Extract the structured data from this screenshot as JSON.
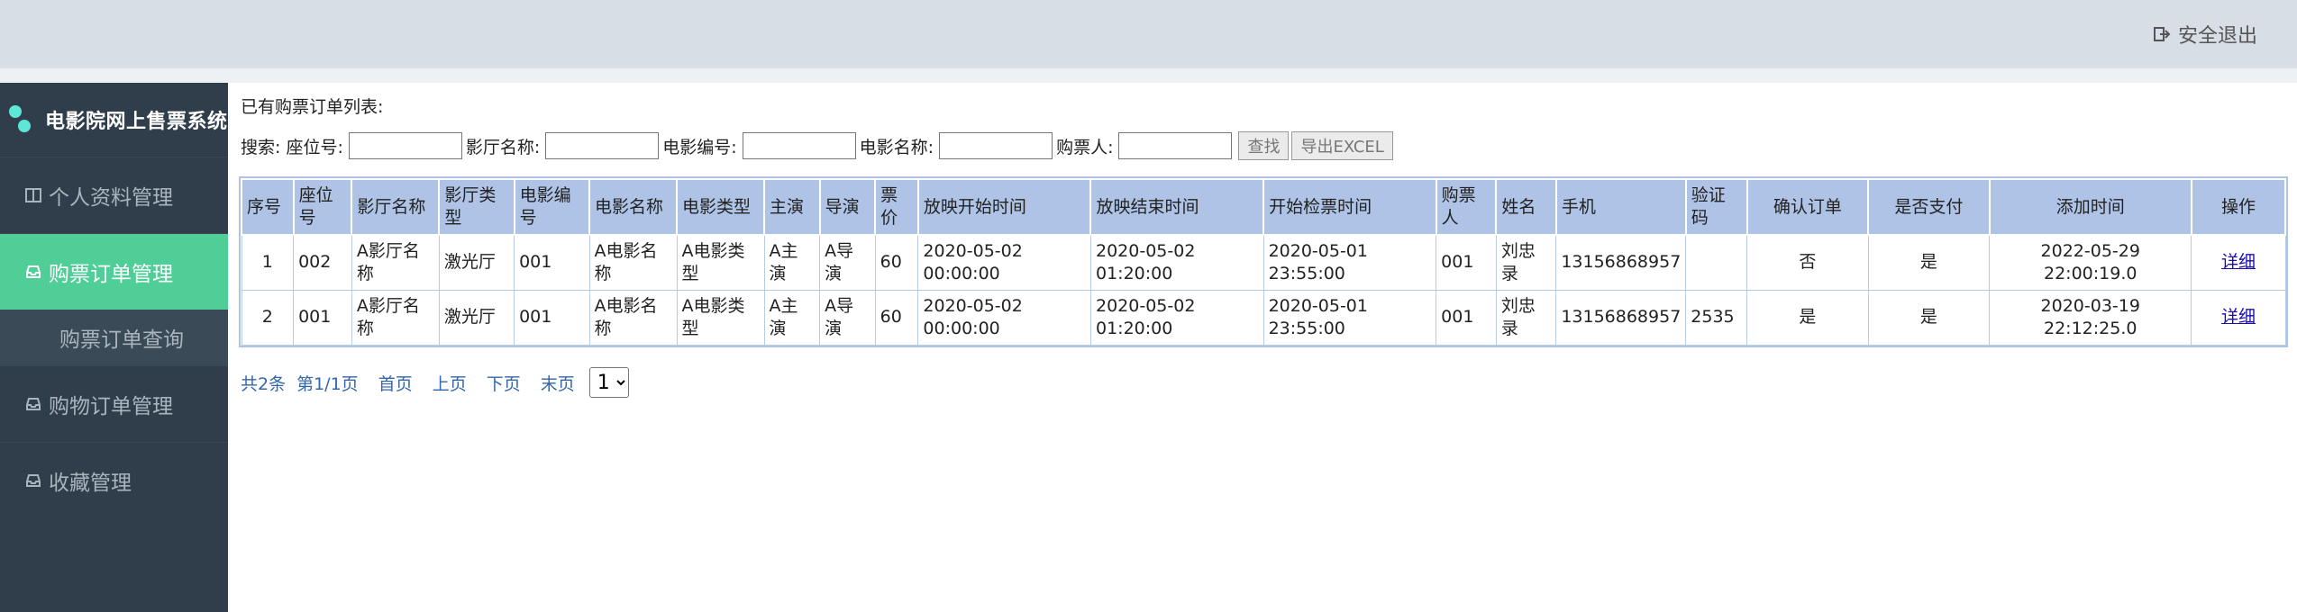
{
  "header": {
    "logout_label": "安全退出"
  },
  "sidebar": {
    "brand": "电影院网上售票系统",
    "items": [
      {
        "label": "个人资料管理",
        "active": false
      },
      {
        "label": "购票订单管理",
        "active": true
      },
      {
        "label": "购物订单管理",
        "active": false
      },
      {
        "label": "收藏管理",
        "active": false
      }
    ],
    "sub_item": "购票订单查询"
  },
  "main": {
    "list_title": "已有购票订单列表:",
    "search": {
      "prefix": "搜索: 座位号:",
      "hall_label": "影厅名称:",
      "movie_no_label": "电影编号:",
      "movie_name_label": "电影名称:",
      "buyer_label": "购票人:",
      "find_button": "查找",
      "export_button": "导出EXCEL",
      "seat_value": "",
      "hall_value": "",
      "movie_no_value": "",
      "movie_name_value": "",
      "buyer_value": ""
    },
    "table": {
      "headers": [
        "序号",
        "座位号",
        "影厅名称",
        "影厅类型",
        "电影编号",
        "电影名称",
        "电影类型",
        "主演",
        "导演",
        "票价",
        "放映开始时间",
        "放映结束时间",
        "开始检票时间",
        "购票人",
        "姓名",
        "手机",
        "验证码",
        "确认订单",
        "是否支付",
        "添加时间",
        "操作"
      ],
      "rows": [
        [
          "1",
          "002",
          "A影厅名称",
          "激光厅",
          "001",
          "A电影名称",
          "A电影类型",
          "A主演",
          "A导演",
          "60",
          "2020-05-02 00:00:00",
          "2020-05-02 01:20:00",
          "2020-05-01 23:55:00",
          "001",
          "刘忠录",
          "13156868957",
          "",
          "否",
          "是",
          "2022-05-29 22:00:19.0",
          "详细"
        ],
        [
          "2",
          "001",
          "A影厅名称",
          "激光厅",
          "001",
          "A电影名称",
          "A电影类型",
          "A主演",
          "A导演",
          "60",
          "2020-05-02 00:00:00",
          "2020-05-02 01:20:00",
          "2020-05-01 23:55:00",
          "001",
          "刘忠录",
          "13156868957",
          "2535",
          "是",
          "是",
          "2020-03-19 22:12:25.0",
          "详细"
        ]
      ]
    },
    "pager": {
      "total": "共2条",
      "page_info": "第1/1页",
      "first": "首页",
      "prev": "上页",
      "next": "下页",
      "last": "末页",
      "selected_page": "1"
    }
  },
  "colors": {
    "header_bg": "#d8dee6",
    "sidebar_bg": "#2f3e4a",
    "active_item": "#4fcf97",
    "table_header": "#aec3e6",
    "link": "#3366aa"
  }
}
